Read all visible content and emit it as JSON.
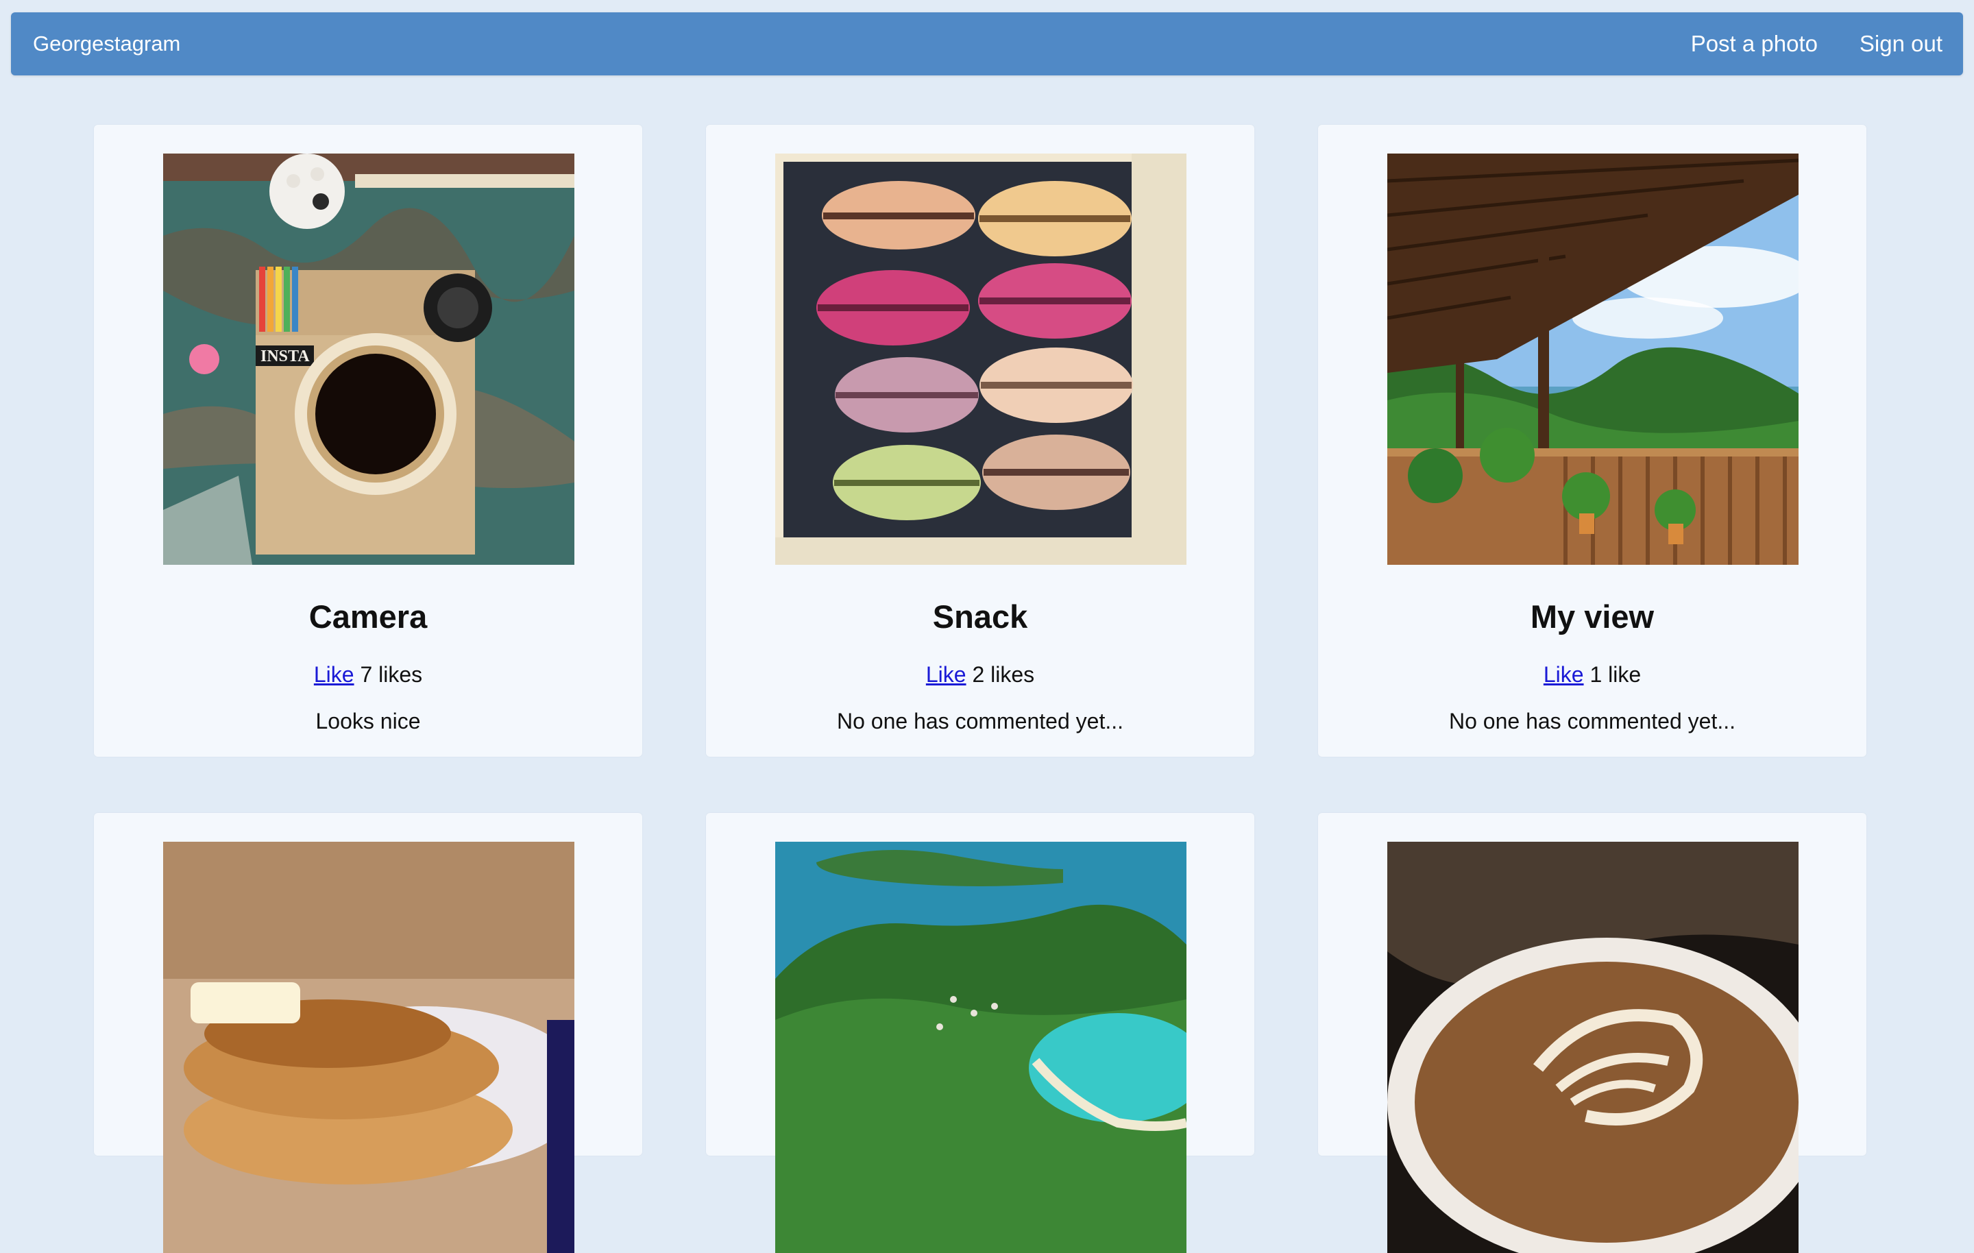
{
  "navbar": {
    "brand": "Georgestagram",
    "post_label": "Post a photo",
    "signout_label": "Sign out",
    "color": "#5089c6"
  },
  "posts": [
    {
      "title": "Camera",
      "like_label": "Like",
      "likes_text": "7 likes",
      "comment": "Looks nice",
      "image": "instagram-camera-craft-photo"
    },
    {
      "title": "Snack",
      "like_label": "Like",
      "likes_text": "2 likes",
      "comment": "No one has commented yet...",
      "image": "macarons-box-photo"
    },
    {
      "title": "My view",
      "like_label": "Like",
      "likes_text": "1 like",
      "comment": "No one has commented yet...",
      "image": "tropical-porch-view-photo"
    },
    {
      "image": "pancakes-photo"
    },
    {
      "image": "island-aerial-photo"
    },
    {
      "image": "latte-art-photo"
    }
  ]
}
